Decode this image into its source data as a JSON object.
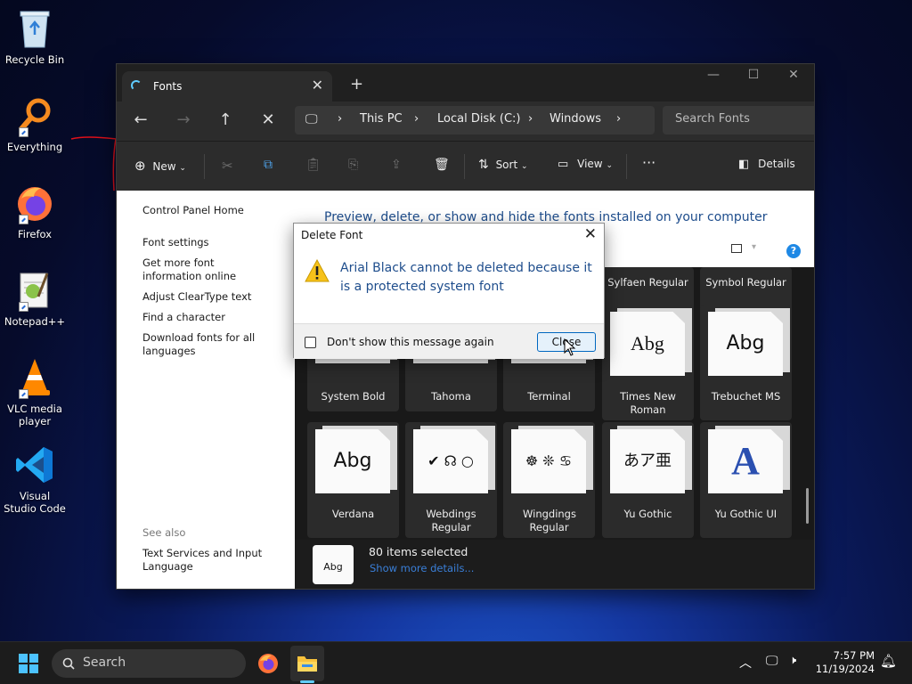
{
  "desktop": {
    "icons": [
      {
        "label": "Recycle Bin",
        "icon": "recycle-bin-icon"
      },
      {
        "label": "Everything",
        "icon": "everything-search-icon"
      },
      {
        "label": "Firefox",
        "icon": "firefox-icon"
      },
      {
        "label": "Notepad++",
        "icon": "notepad-plus-plus-icon"
      },
      {
        "label": "VLC media player",
        "icon": "vlc-icon"
      },
      {
        "label": "Visual Studio Code",
        "icon": "vscode-icon"
      }
    ]
  },
  "explorer": {
    "tab_title": "Fonts",
    "address": [
      "This PC",
      "Local Disk (C:)",
      "Windows"
    ],
    "search_placeholder": "Search Fonts",
    "toolbar": {
      "new": "New",
      "sort": "Sort",
      "view": "View",
      "details": "Details"
    },
    "left_pane": {
      "links": [
        "Control Panel Home",
        "Font settings",
        "Get more font information online",
        "Adjust ClearType text",
        "Find a character",
        "Download fonts for all languages"
      ],
      "see_also_header": "See also",
      "see_also": "Text Services and Input Language"
    },
    "heading": "Preview, delete, or show and hide the fonts installed on your computer",
    "fonts_row1": [
      "Sylfaen Regular",
      "Symbol Regular"
    ],
    "fonts_row2": [
      {
        "name": "System Bold",
        "sample": ""
      },
      {
        "name": "Tahoma",
        "sample": ""
      },
      {
        "name": "Terminal",
        "sample": ""
      },
      {
        "name": "Times New Roman",
        "sample": "Abg"
      },
      {
        "name": "Trebuchet MS",
        "sample": "Abg"
      }
    ],
    "fonts_row3": [
      {
        "name": "Verdana",
        "sample": "Abg"
      },
      {
        "name": "Webdings Regular",
        "sample": "✔ ☊ ○"
      },
      {
        "name": "Wingdings Regular",
        "sample": "☸ ❊ ♋"
      },
      {
        "name": "Yu Gothic",
        "sample": "あア亜"
      },
      {
        "name": "Yu Gothic UI",
        "sample": "A"
      }
    ],
    "status": {
      "count": "80 items selected",
      "more": "Show more details...",
      "thumb": "Abg"
    }
  },
  "dialog": {
    "title": "Delete Font",
    "message": "Arial Black cannot be deleted because it is a protected system font",
    "checkbox_label": "Don't show this message again",
    "close_button": "Close"
  },
  "taskbar": {
    "search": "Search",
    "time": "7:57 PM",
    "date": "11/19/2024"
  },
  "colors": {
    "accent": "#60cdff",
    "link_blue": "#1e4d8c",
    "warning": "#f7c21a"
  }
}
